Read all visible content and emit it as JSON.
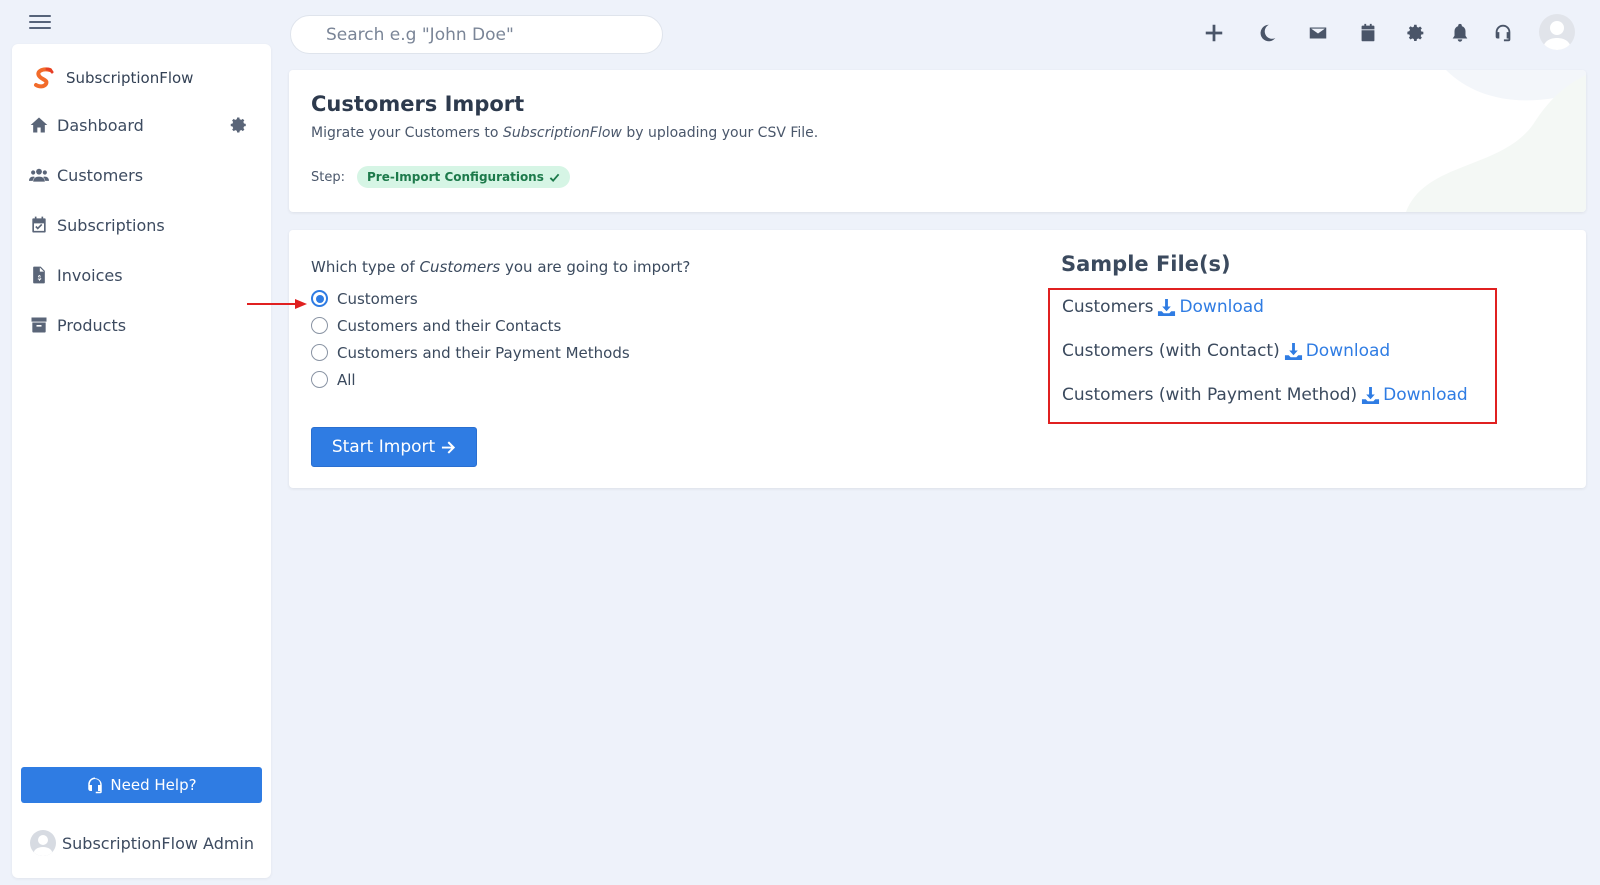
{
  "search": {
    "placeholder": "Search e.g \"John Doe\""
  },
  "sidebar": {
    "brand": "SubscriptionFlow",
    "items": [
      {
        "label": "Dashboard",
        "icon": "home-icon"
      },
      {
        "label": "Customers",
        "icon": "users-icon"
      },
      {
        "label": "Subscriptions",
        "icon": "calendar-check-icon"
      },
      {
        "label": "Invoices",
        "icon": "invoice-icon"
      },
      {
        "label": "Products",
        "icon": "archive-icon"
      }
    ],
    "help_label": "Need Help?",
    "admin_name": "SubscriptionFlow Admin"
  },
  "header": {
    "title": "Customers Import",
    "subtitle_pre": "Migrate your Customers to ",
    "subtitle_brand": "SubscriptionFlow",
    "subtitle_post": " by uploading your CSV File.",
    "step_label": "Step:",
    "step_value": "Pre-Import Configurations"
  },
  "import": {
    "question_pre": "Which type of ",
    "question_em": "Customers",
    "question_post": " you are going to import?",
    "options": [
      {
        "label": "Customers",
        "checked": true
      },
      {
        "label": "Customers and their Contacts",
        "checked": false
      },
      {
        "label": "Customers and their Payment Methods",
        "checked": false
      },
      {
        "label": "All",
        "checked": false
      }
    ],
    "start_label": "Start Import"
  },
  "samples": {
    "title": "Sample File(s)",
    "download_label": "Download",
    "files": [
      {
        "label": "Customers"
      },
      {
        "label": "Customers (with Contact)"
      },
      {
        "label": "Customers (with Payment Method)"
      }
    ]
  },
  "colors": {
    "primary": "#2f7ce3",
    "highlight": "#e02020",
    "badge_bg": "#d6f5e5",
    "badge_text": "#1d7a4b"
  }
}
